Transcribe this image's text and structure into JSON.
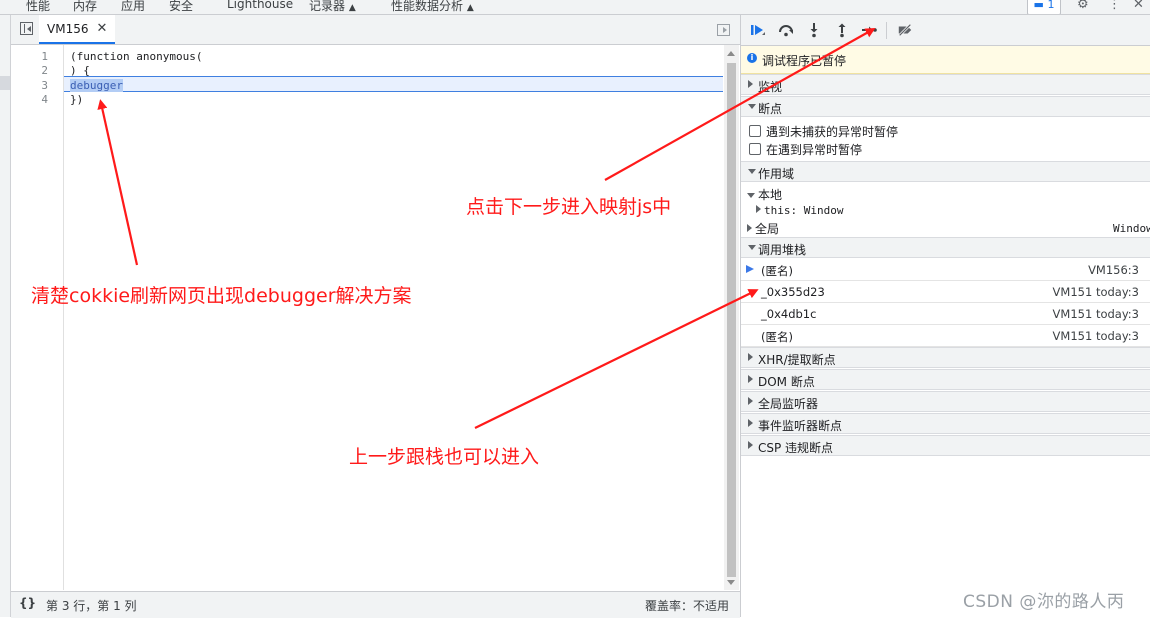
{
  "topbar": {
    "tabs": [
      "性能",
      "内存",
      "应用",
      "安全",
      "Lighthouse",
      "记录器",
      "性能数据分析"
    ],
    "badge_count": "1",
    "icons": [
      "message-icon",
      "gear-icon",
      "more-icon",
      "close-icon"
    ]
  },
  "editor": {
    "file_tab": "VM156",
    "lines": [
      {
        "num": "1",
        "text": "(function anonymous("
      },
      {
        "num": "2",
        "text": ") {"
      },
      {
        "num": "3",
        "text": "debugger"
      },
      {
        "num": "4",
        "text": "})"
      }
    ],
    "status": {
      "braces": "{}",
      "position": "第 3 行，第 1 列",
      "coverage": "覆盖率：不适用"
    }
  },
  "debugger": {
    "toolbar_icons": [
      "resume-icon",
      "step-over-icon",
      "step-into-icon",
      "step-out-icon",
      "step-icon",
      "deactivate-breakpoints-icon"
    ],
    "paused_message": "调试程序已暂停",
    "sections": {
      "watch": "监视",
      "breakpoints": "断点",
      "scope": "作用域",
      "call_stack": "调用堆栈",
      "xhr": "XHR/提取断点",
      "dom": "DOM 断点",
      "global_listeners": "全局监听器",
      "event_listeners": "事件监听器断点",
      "csp": "CSP 违规断点"
    },
    "breakpoint_options": [
      "遇到未捕获的异常时暂停",
      "在遇到异常时暂停"
    ],
    "scope": {
      "local": "本地",
      "this_label": "this: Window",
      "global": "全局",
      "global_value": "Window"
    },
    "call_stack": [
      {
        "name": "(匿名)",
        "location": "VM156:3",
        "current": true
      },
      {
        "name": "_0x355d23",
        "location": "VM151 today:3",
        "current": false
      },
      {
        "name": "_0x4db1c",
        "location": "VM151 today:3",
        "current": false
      },
      {
        "name": "(匿名)",
        "location": "VM151 today:3",
        "current": false
      }
    ]
  },
  "annotations": {
    "a1": "清楚cokkie刷新网页出现debugger解决方案",
    "a2": "点击下一步进入映射js中",
    "a3": "上一步跟栈也可以进入",
    "color": "#ff1a1a"
  },
  "watermark": "CSDN @沵的路人丙"
}
